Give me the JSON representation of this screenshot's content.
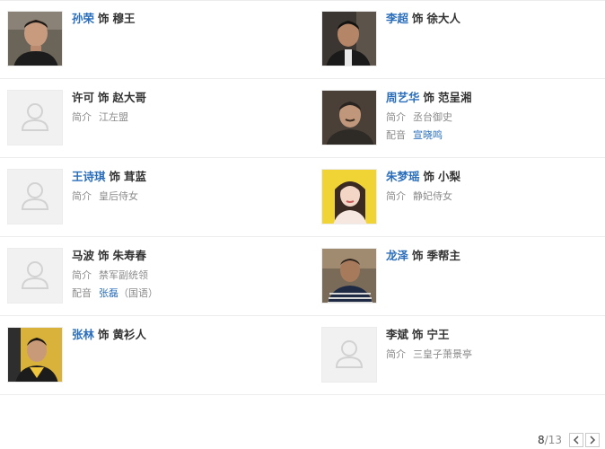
{
  "cast": [
    {
      "actor": "孙荣",
      "actor_link": true,
      "connector": "饰",
      "role": "穆王",
      "intro_label": "",
      "intro": "",
      "dub_label": "",
      "dub": "",
      "dub_note": "",
      "photo": "man-1",
      "photo_bg": "#6b6458"
    },
    {
      "actor": "李超",
      "actor_link": true,
      "connector": "饰",
      "role": "徐大人",
      "intro_label": "",
      "intro": "",
      "dub_label": "",
      "dub": "",
      "dub_note": "",
      "photo": "man-2",
      "photo_bg": "#3b3631"
    },
    {
      "actor": "许可",
      "actor_link": false,
      "connector": "饰",
      "role": "赵大哥",
      "intro_label": "简介",
      "intro": "江左盟",
      "dub_label": "",
      "dub": "",
      "dub_note": "",
      "photo": "placeholder"
    },
    {
      "actor": "周艺华",
      "actor_link": true,
      "connector": "饰",
      "role": "范呈湘",
      "intro_label": "简介",
      "intro": "丞台御史",
      "dub_label": "配音",
      "dub": "宣晓鸣",
      "dub_note": "",
      "photo": "man-3",
      "photo_bg": "#4a4038"
    },
    {
      "actor": "王诗琪",
      "actor_link": true,
      "connector": "饰",
      "role": "茸蓝",
      "intro_label": "简介",
      "intro": "皇后侍女",
      "dub_label": "",
      "dub": "",
      "dub_note": "",
      "photo": "placeholder"
    },
    {
      "actor": "朱梦瑶",
      "actor_link": true,
      "connector": "饰",
      "role": "小梨",
      "intro_label": "简介",
      "intro": "静妃侍女",
      "dub_label": "",
      "dub": "",
      "dub_note": "",
      "photo": "woman-1",
      "photo_bg": "#f0d435"
    },
    {
      "actor": "马波",
      "actor_link": false,
      "connector": "饰",
      "role": "朱寿春",
      "intro_label": "简介",
      "intro": "禁军副统领",
      "dub_label": "配音",
      "dub": "张磊",
      "dub_note": "（国语）",
      "photo": "placeholder"
    },
    {
      "actor": "龙泽",
      "actor_link": true,
      "connector": "饰",
      "role": "季帮主",
      "intro_label": "",
      "intro": "",
      "dub_label": "",
      "dub": "",
      "dub_note": "",
      "photo": "man-4",
      "photo_bg": "#7a6a58"
    },
    {
      "actor": "张林",
      "actor_link": true,
      "connector": "饰",
      "role": "黄衫人",
      "intro_label": "",
      "intro": "",
      "dub_label": "",
      "dub": "",
      "dub_note": "",
      "photo": "man-5",
      "photo_bg": "#d8b23a"
    },
    {
      "actor": "李斌",
      "actor_link": false,
      "connector": "饰",
      "role": "宁王",
      "intro_label": "简介",
      "intro": "三皇子萧景亭",
      "dub_label": "",
      "dub": "",
      "dub_note": "",
      "photo": "placeholder"
    }
  ],
  "pager": {
    "current": "8",
    "separator": "/",
    "total": "13",
    "prev_icon": "chevron-left-icon",
    "next_icon": "chevron-right-icon"
  },
  "colors": {
    "link": "#2a6ebb",
    "text": "#333333",
    "muted": "#8b8b8b",
    "divider": "#ececec"
  }
}
